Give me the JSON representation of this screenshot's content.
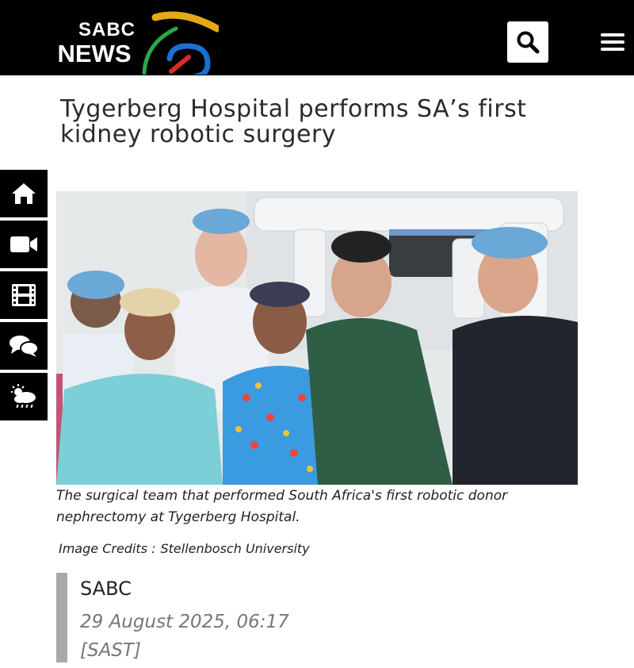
{
  "header": {
    "logo": {
      "line1": "SABC",
      "line2": "NEWS"
    },
    "search_icon": "search-icon",
    "menu_icon": "hamburger-menu-icon",
    "colors": {
      "background": "#000000",
      "logo_swoosh_yellow": "#e6a817",
      "logo_swoosh_green": "#2aa84a",
      "logo_swoosh_blue": "#1c6fd1",
      "logo_swoosh_red": "#d62b2b"
    }
  },
  "article": {
    "title": "Tygerberg Hospital performs SA’s first kidney robotic surgery",
    "image_caption": "The surgical team that performed South Africa's first robotic donor nephrectomy at Tygerberg Hospital.",
    "image_credits_label": "Image Credits :",
    "image_credits_value": "Stellenbosch University",
    "author": "SABC",
    "date": "29 August 2025, 06:17",
    "timezone": "[SAST]"
  },
  "side_rail": {
    "items": [
      {
        "icon": "home-icon"
      },
      {
        "icon": "video-camera-icon"
      },
      {
        "icon": "film-icon"
      },
      {
        "icon": "chat-bubbles-icon"
      },
      {
        "icon": "weather-icon"
      }
    ]
  }
}
